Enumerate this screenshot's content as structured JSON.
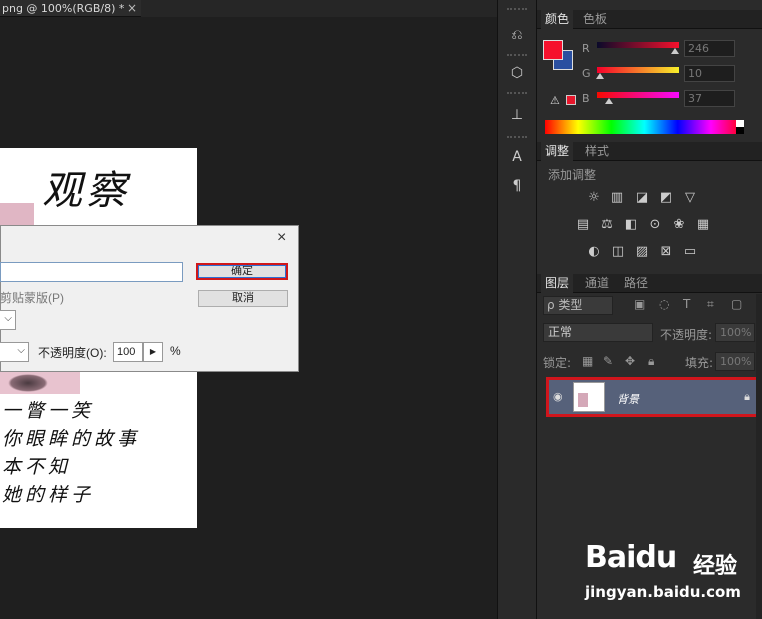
{
  "document": {
    "tab_title": "png @ 100%(RGB/8) *",
    "tab_close": "×",
    "canvas": {
      "title_text": "观察",
      "poem_lines": [
        "一瞥一笑",
        "你眼眸的故事",
        "本不知",
        "她的样子"
      ]
    }
  },
  "dialog": {
    "close": "×",
    "ok_label": "确定",
    "cancel_label": "取消",
    "clip_label": "剪贴蒙版(P)",
    "opacity_label": "不透明度(O):",
    "opacity_value": "100",
    "opacity_unit": "%"
  },
  "panels": {
    "color": {
      "tabs": [
        "颜色",
        "色板"
      ],
      "channels": [
        {
          "label": "R",
          "value": "246"
        },
        {
          "label": "G",
          "value": "10"
        },
        {
          "label": "B",
          "value": "37"
        }
      ],
      "foreground": "#f6102c",
      "background": "#2a4fa0"
    },
    "adjustments": {
      "tabs": [
        "调整",
        "样式"
      ],
      "add_label": "添加调整"
    },
    "layers": {
      "tabs": [
        "图层",
        "通道",
        "路径"
      ],
      "filter_label": "ρ 类型",
      "blend_mode": "正常",
      "opacity_label": "不透明度:",
      "opacity_value": "100%",
      "lock_label": "锁定:",
      "fill_label": "填充:",
      "fill_value": "100%",
      "layer_name": "背景"
    }
  },
  "watermark": {
    "brand": "Baidu",
    "brand_cn": "经验",
    "url": "jingyan.baidu.com"
  }
}
